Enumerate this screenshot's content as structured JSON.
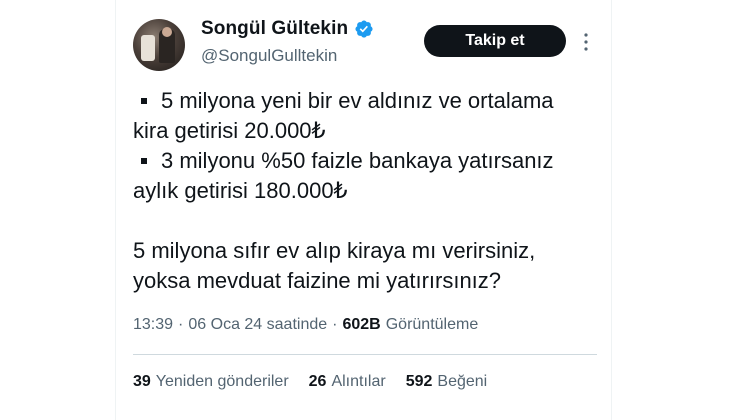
{
  "author": {
    "name": "Songül Gültekin",
    "handle": "@SongulGulltekin"
  },
  "actions": {
    "follow_label": "Takip et"
  },
  "tweet": {
    "bullet_1_line_1": "5 milyona yeni bir ev aldınız ve ortalama",
    "bullet_1_line_2": "kira getirisi 20.000₺",
    "bullet_2_line_1": "3 milyonu %50 faizle bankaya yatırsanız",
    "bullet_2_line_2": "aylık getirisi 180.000₺",
    "question_line_1": "5 milyona sıfır ev alıp kiraya mı verirsiniz,",
    "question_line_2": "yoksa mevduat faizine mi yatırırsınız?"
  },
  "meta": {
    "time": "13:39",
    "date": "06 Oca 24 saatinde",
    "separator": "·",
    "views_count": "602B",
    "views_label": "Görüntüleme"
  },
  "stats": {
    "retweets_count": "39",
    "retweets_label": "Yeniden gönderiler",
    "quotes_count": "26",
    "quotes_label": "Alıntılar",
    "likes_count": "592",
    "likes_label": "Beğeni"
  },
  "colors": {
    "verified": "#1d9bf0",
    "secondary_text": "#536471",
    "button_bg": "#0f1419"
  },
  "icons": {
    "verified": "verified-badge-icon",
    "more": "more-vertical-icon"
  }
}
